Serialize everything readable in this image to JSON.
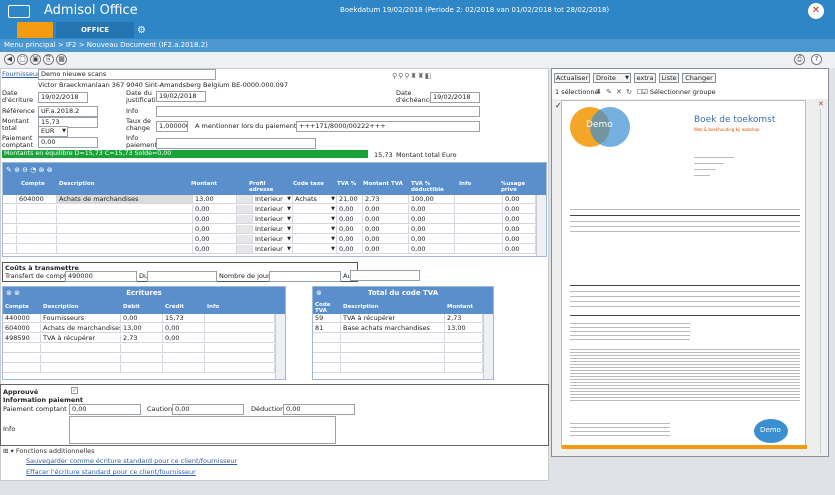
{
  "app": {
    "title": "Admisol Office",
    "header_info": "Boekdatum 19/02/2018 (Periode 2: 02/2018 van 01/02/2018 tot 28/02/2018)",
    "tab_office": "OFFICE"
  },
  "breadcrumb": {
    "path": "Menu principal  > IF2  > Nouveau Document (IF2.a.2018.2)"
  },
  "form": {
    "fournisseur_label": "Fournisseur",
    "fournisseur": "Demo nieuwe scans",
    "address": "Victor Braeckmanlaan 367 9040 Sint-Amandsberg Belgium BE-0000.000.097",
    "date_ecriture_label": "Date d'écriture",
    "date_ecriture": "19/02/2018",
    "date_justificatif_label": "Date du justificatif",
    "date_justificatif": "19/02/2018",
    "date_echeance_label": "Date d'échéance",
    "date_echeance": "19/02/2018",
    "reference_label": "Référence",
    "reference": "UF.a.2018.2",
    "info_label": "Info",
    "montant_total_label": "Montant total",
    "montant_total": "15,73",
    "currency": "EUR",
    "taux_label": "Taux de change",
    "taux": "1,000000",
    "mentionner_label": "A mentionner lors du paiement:",
    "mentionner": "+++171/8000/00222+++",
    "paiement_label": "Paiement comptant",
    "paiement": "0,00",
    "info_paiement_label": "Info paiement",
    "status": "Montants en équilibre D=15,73 C=15,73 Solde=0,00",
    "status_amount": "15,73",
    "status_amount_label": "Montant total Euro"
  },
  "lines": {
    "headers": [
      "Compte",
      "Description",
      "Montant",
      "Profil adresse",
      "Code taxe",
      "TVA %",
      "Montant TVA",
      "TVA % déductible",
      "Info",
      "%usage privé"
    ],
    "rows": [
      {
        "compte": "604000",
        "desc": "Achats de marchandises",
        "montant": "13,00",
        "profil": "Interieur",
        "code": "Achats",
        "tva": "21,00",
        "mtva": "2,73",
        "ded": "100,00",
        "priv": "0,00"
      },
      {
        "compte": "",
        "desc": "",
        "montant": "0,00",
        "profil": "Interieur",
        "code": "",
        "tva": "0,00",
        "mtva": "0,00",
        "ded": "0,00",
        "priv": "0,00"
      },
      {
        "compte": "",
        "desc": "",
        "montant": "0,00",
        "profil": "Interieur",
        "code": "",
        "tva": "0,00",
        "mtva": "0,00",
        "ded": "0,00",
        "priv": "0,00"
      },
      {
        "compte": "",
        "desc": "",
        "montant": "0,00",
        "profil": "Interieur",
        "code": "",
        "tva": "0,00",
        "mtva": "0,00",
        "ded": "0,00",
        "priv": "0,00"
      },
      {
        "compte": "",
        "desc": "",
        "montant": "0,00",
        "profil": "Interieur",
        "code": "",
        "tva": "0,00",
        "mtva": "0,00",
        "ded": "0,00",
        "priv": "0,00"
      },
      {
        "compte": "",
        "desc": "",
        "montant": "0,00",
        "profil": "Interieur",
        "code": "",
        "tva": "0,00",
        "mtva": "0,00",
        "ded": "0,00",
        "priv": "0,00"
      }
    ]
  },
  "couts": {
    "title": "Coûts à transmettre",
    "transfert_label": "Transfert de compte",
    "transfert": "490000",
    "du_label": "Du",
    "nb_label": "Nombre de jours",
    "au_label": "Au"
  },
  "ecritures": {
    "title": "Ecritures",
    "headers": [
      "Compte",
      "Description",
      "Débit",
      "Crédit",
      "Info"
    ],
    "rows": [
      {
        "compte": "440000",
        "desc": "Fournisseurs",
        "debit": "0,00",
        "credit": "15,73"
      },
      {
        "compte": "604000",
        "desc": "Achats de marchandises",
        "debit": "13,00",
        "credit": "0,00"
      },
      {
        "compte": "498590",
        "desc": "TVA à récupérer",
        "debit": "2,73",
        "credit": "0,00"
      }
    ]
  },
  "totaltva": {
    "title": "Total du code TVA",
    "headers": [
      "Code TVA",
      "Description",
      "Montant"
    ],
    "rows": [
      {
        "code": "59",
        "desc": "TVA à récupérer",
        "montant": "2,73"
      },
      {
        "code": "81",
        "desc": "Base achats marchandises",
        "montant": "13,00"
      }
    ]
  },
  "approval": {
    "approuve": "Approuvé",
    "info_paiement": "Information paiement",
    "paiement_label": "Paiement comptant",
    "paiement": "0,00",
    "caution_label": "Caution",
    "caution": "0,00",
    "deduction_label": "Déduction",
    "deduction": "0,00",
    "info_label": "Info"
  },
  "functions": {
    "title": "Fonctions additionnelles",
    "save": "Sauvegarder comme écriture standard pour ce client/fournisseur",
    "erase": "Effacer l'écriture standard pour ce client/fournisseur"
  },
  "viewer": {
    "actualiser": "Actualiser",
    "droite": "Droite",
    "extra": "extra",
    "liste": "Liste",
    "changer": "Changer",
    "selection_count": "1 sélectionné",
    "select_group": "Sélectionner groupe"
  },
  "invoice": {
    "logo": "Demo",
    "title": "Boek de toekomst",
    "subtitle": "Web & boekhouding bij webshop"
  }
}
